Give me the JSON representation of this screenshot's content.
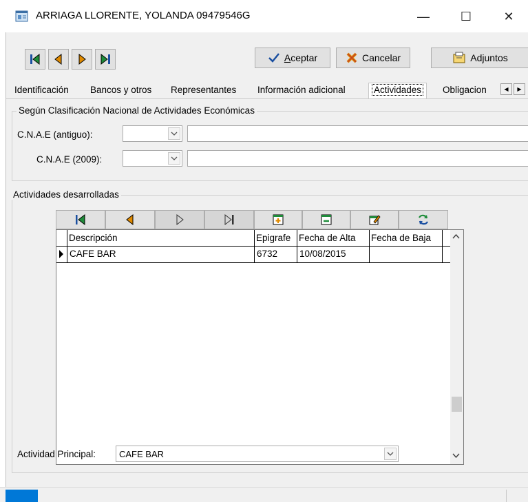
{
  "window": {
    "title": "ARRIAGA LLORENTE, YOLANDA  09479546G",
    "minimize_glyph": "—",
    "maximize_glyph": "☐",
    "close_glyph": "✕"
  },
  "toolbar": {
    "nav_icons": [
      "first-record-icon",
      "prev-record-icon",
      "next-record-icon",
      "last-record-icon"
    ],
    "accept_label_prefix": "A",
    "accept_label_rest": "ceptar",
    "cancel_label": "Cancelar",
    "attachments_label": "Adjuntos"
  },
  "tabs": [
    {
      "label": "Identificación"
    },
    {
      "label": "Bancos y otros"
    },
    {
      "label": "Representantes"
    },
    {
      "label": "Información adicional"
    },
    {
      "label": "Actividades"
    },
    {
      "label": "Obligacion"
    }
  ],
  "active_tab": "Actividades",
  "cnae_group": {
    "title": "Según Clasificación Nacional de Actividades Económicas",
    "old_label": "C.N.A.E (antiguo):",
    "old_value": "",
    "old_text": "",
    "new_label": "C.N.A.E (2009):",
    "new_value": "",
    "new_text": ""
  },
  "activities_group": {
    "title": "Actividades desarrolladas",
    "grid_toolbar_icons": [
      "first-record-icon",
      "prev-record-icon",
      "next-record-icon",
      "last-record-icon",
      "insert-record-icon",
      "delete-record-icon",
      "edit-record-icon",
      "refresh-icon"
    ],
    "columns": [
      "Descripción",
      "Epigrafe",
      "Fecha de Alta",
      "Fecha de Baja"
    ],
    "rows": [
      {
        "descripcion": "CAFE BAR",
        "epigrafe": "6732",
        "fecha_alta": "10/08/2015",
        "fecha_baja": ""
      }
    ]
  },
  "principal": {
    "label": "Actividad Principal:",
    "value": "CAFE BAR"
  },
  "colors": {
    "accent": "#0078d7",
    "nav_green": "#1e8c3a",
    "nav_orange": "#e08a00",
    "nav_blue": "#1a4fa0"
  }
}
